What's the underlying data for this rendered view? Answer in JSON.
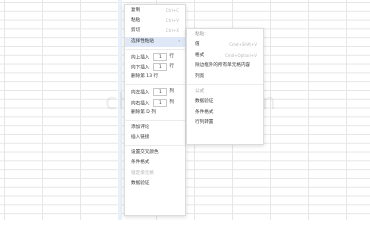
{
  "watermark": "chazidian.com",
  "menu": {
    "copy": {
      "label": "复制",
      "shortcut": "Ctrl+C"
    },
    "paste": {
      "label": "粘贴",
      "shortcut": "Ctrl+V"
    },
    "cut": {
      "label": "剪切",
      "shortcut": "Ctrl+X"
    },
    "paste_special": {
      "label": "选择性粘贴"
    },
    "insert_row_above": {
      "label": "向上插入",
      "value": "1",
      "suffix": "行"
    },
    "insert_row_below": {
      "label": "向下插入",
      "value": "1",
      "suffix": "行"
    },
    "delete_row": {
      "label": "删除第 13 行"
    },
    "insert_col_left": {
      "label": "向左插入",
      "value": "1",
      "suffix": "列"
    },
    "insert_col_right": {
      "label": "向右插入",
      "value": "1",
      "suffix": "列"
    },
    "delete_col": {
      "label": "删除第 D 列"
    },
    "add_comment": {
      "label": "添加评论"
    },
    "insert_link": {
      "label": "插入链接"
    },
    "alternate_colors": {
      "label": "设置交叉颜色"
    },
    "conditional_format": {
      "label": "条件格式"
    },
    "freeze": {
      "label": "锁定单元格"
    },
    "data_validation": {
      "label": "数据验证"
    }
  },
  "submenu": {
    "header_paste": "粘贴:",
    "values": {
      "label": "值",
      "shortcut": "Cmd+Shift+V"
    },
    "formats": {
      "label": "格式",
      "shortcut": "Cmd+Option+V"
    },
    "all_except_borders": {
      "label": "除边框外的所有单元格内容"
    },
    "column_width": {
      "label": "列宽"
    },
    "header_other": "公式",
    "data_validation": {
      "label": "数据验证"
    },
    "conditional_format": {
      "label": "条件格式"
    },
    "transpose": {
      "label": "行列转置"
    }
  }
}
